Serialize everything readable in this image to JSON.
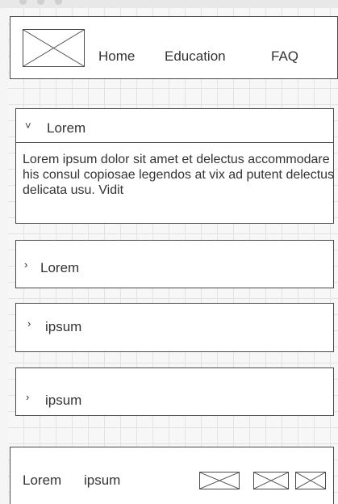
{
  "header": {
    "nav": [
      {
        "label": "Home"
      },
      {
        "label": "Education"
      },
      {
        "label": "FAQ"
      }
    ]
  },
  "accordion": {
    "items": [
      {
        "title": "Lorem",
        "expanded": true,
        "icon": "chevron-down-icon",
        "body": "Lorem ipsum dolor sit amet et delectus accommodare his consul copiosae legendos at vix ad putent delectus delicata usu. Vidit"
      },
      {
        "title": "Lorem",
        "expanded": false,
        "icon": "chevron-right-icon"
      },
      {
        "title": "ipsum",
        "expanded": false,
        "icon": "chevron-right-icon"
      },
      {
        "title": "ipsum",
        "expanded": false,
        "icon": "chevron-right-icon"
      }
    ]
  },
  "footer": {
    "links": [
      {
        "label": "Lorem"
      },
      {
        "label": "ipsum"
      }
    ]
  }
}
